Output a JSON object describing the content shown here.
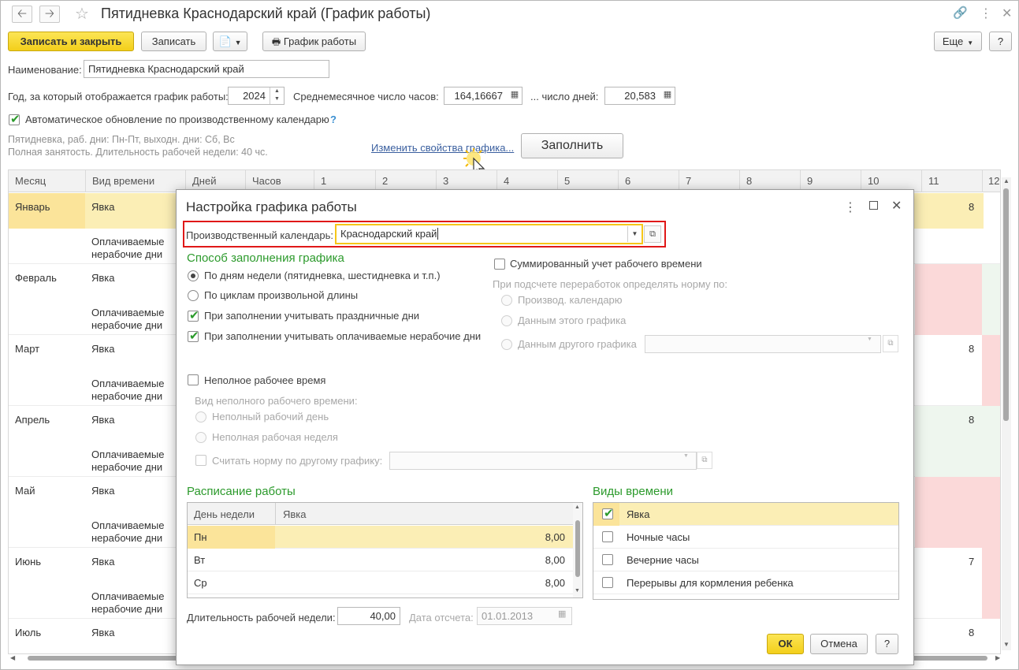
{
  "window": {
    "title": "Пятидневка Краснодарский край (График работы)",
    "icons": {
      "back": "back-arrow-icon",
      "forward": "forward-arrow-icon",
      "favorite": "star-icon",
      "link": "link-icon",
      "menu": "more-vert-icon",
      "close": "close-icon"
    }
  },
  "toolbar": {
    "save_close": "Записать и закрыть",
    "save": "Записать",
    "schedule": "График работы",
    "more": "Еще",
    "help": "?"
  },
  "form": {
    "name_label": "Наименование:",
    "name_value": "Пятидневка Краснодарский край",
    "year_label": "Год, за который отображается график работы:",
    "year_value": "2024",
    "avg_hours_label": "Среднемесячное число часов:",
    "avg_hours_value": "164,16667",
    "days_label": "... число дней:",
    "days_value": "20,583",
    "auto_update_label": "Автоматическое обновление по производственному календарю",
    "auto_update_help": "?",
    "summary_line1": "Пятидневка, раб. дни: Пн-Пт, выходн. дни: Сб, Вс",
    "summary_line2": "Полная занятость. Длительность рабочей недели: 40 чс.",
    "change_link": "Изменить свойства графика...",
    "fill_button": "Заполнить"
  },
  "grid": {
    "columns": [
      "Месяц",
      "Вид времени",
      "Дней",
      "Часов",
      "1",
      "2",
      "3",
      "4",
      "5",
      "6",
      "7",
      "8",
      "9",
      "10",
      "11",
      "12"
    ],
    "rows": [
      {
        "month": "Январь",
        "kind1": "Явка",
        "kind2a": "Оплачиваемые",
        "kind2b": "нерабочие дни",
        "d11": "8"
      },
      {
        "month": "Февраль",
        "kind1": "Явка",
        "kind2a": "Оплачиваемые",
        "kind2b": "нерабочие дни",
        "d11": ""
      },
      {
        "month": "Март",
        "kind1": "Явка",
        "kind2a": "Оплачиваемые",
        "kind2b": "нерабочие дни",
        "d11": "8"
      },
      {
        "month": "Апрель",
        "kind1": "Явка",
        "kind2a": "Оплачиваемые",
        "kind2b": "нерабочие дни",
        "d11": "8"
      },
      {
        "month": "Май",
        "kind1": "Явка",
        "kind2a": "Оплачиваемые",
        "kind2b": "нерабочие дни",
        "d11": ""
      },
      {
        "month": "Июнь",
        "kind1": "Явка",
        "kind2a": "Оплачиваемые",
        "kind2b": "нерабочие дни",
        "d11": "7"
      },
      {
        "month": "Июль",
        "kind1": "Явка",
        "kind2a": "",
        "kind2b": "",
        "d11": "8"
      }
    ],
    "colors": {
      "selected_row": "#fbeeb5",
      "holiday": "#fbd9d9",
      "workday": "#eef6ee"
    }
  },
  "dialog": {
    "title": "Настройка графика работы",
    "calendar_label": "Производственный календарь:",
    "calendar_value": "Краснодарский край",
    "fill_method_title": "Способ заполнения графика",
    "opt_weekdays": "По дням недели (пятидневка, шестидневка и т.п.)",
    "opt_cycles": "По циклам произвольной длины",
    "chk_holidays": "При заполнении учитывать праздничные дни",
    "chk_paid_nonwork": "При заполнении учитывать оплачиваемые нерабочие дни",
    "summed_label": "Суммированный учет рабочего времени",
    "overtime_label": "При подсчете переработок определять норму по:",
    "ot_opt1": "Производ. календарю",
    "ot_opt2": "Данным этого графика",
    "ot_opt3": "Данным другого графика",
    "part_time_label": "Неполное рабочее время",
    "part_time_kind_label": "Вид неполного рабочего времени:",
    "pt_opt1": "Неполный рабочий день",
    "pt_opt2": "Неполная рабочая неделя",
    "pt_other_label": "Считать норму по другому графику:",
    "schedule_title": "Расписание работы",
    "schedule_headers": [
      "День недели",
      "Явка"
    ],
    "schedule_rows": [
      {
        "day": "Пн",
        "value": "8,00"
      },
      {
        "day": "Вт",
        "value": "8,00"
      },
      {
        "day": "Ср",
        "value": "8,00"
      }
    ],
    "time_kinds_title": "Виды времени",
    "time_kinds": [
      {
        "label": "Явка",
        "checked": true
      },
      {
        "label": "Ночные часы",
        "checked": false
      },
      {
        "label": "Вечерние часы",
        "checked": false
      },
      {
        "label": "Перерывы для кормления ребенка",
        "checked": false
      }
    ],
    "week_duration_label": "Длительность рабочей недели:",
    "week_duration_value": "40,00",
    "ref_date_label": "Дата отсчета:",
    "ref_date_value": "01.01.2013",
    "ok": "ОК",
    "cancel": "Отмена",
    "help": "?"
  }
}
